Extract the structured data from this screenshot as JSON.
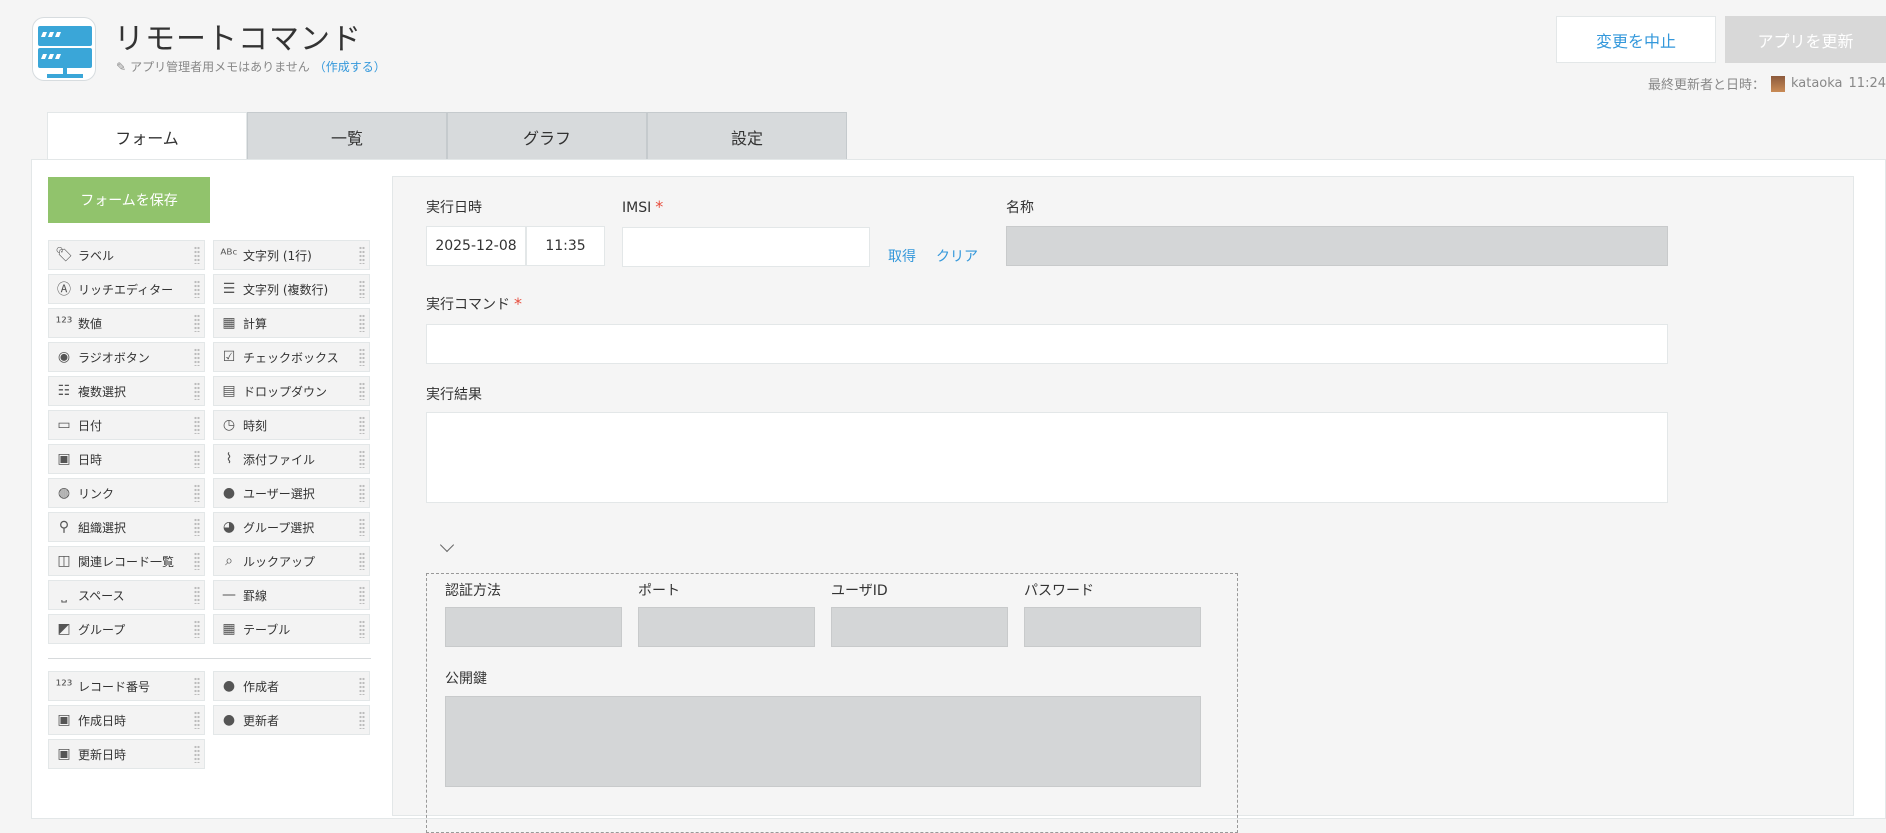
{
  "app": {
    "title": "リモートコマンド",
    "memo_text": "アプリ管理者用メモはありません",
    "memo_link": "（作成する）"
  },
  "header": {
    "cancel_label": "変更を中止",
    "update_label": "アプリを更新",
    "last_updated_label": "最終更新者と日時：",
    "last_updated_user": "kataoka",
    "last_updated_time": "11:24"
  },
  "tabs": [
    {
      "label": "フォーム"
    },
    {
      "label": "一覧"
    },
    {
      "label": "グラフ"
    },
    {
      "label": "設定"
    }
  ],
  "save_form_label": "フォームを保存",
  "palette": {
    "fields": [
      {
        "label": "ラベル",
        "icon": "tag-icon"
      },
      {
        "label": "文字列 (1行)",
        "icon": "abc-icon"
      },
      {
        "label": "リッチエディター",
        "icon": "richtext-icon"
      },
      {
        "label": "文字列 (複数行)",
        "icon": "multiline-icon"
      },
      {
        "label": "数値",
        "icon": "number-icon"
      },
      {
        "label": "計算",
        "icon": "calculator-icon"
      },
      {
        "label": "ラジオボタン",
        "icon": "radio-icon"
      },
      {
        "label": "チェックボックス",
        "icon": "checkbox-icon"
      },
      {
        "label": "複数選択",
        "icon": "multiselect-icon"
      },
      {
        "label": "ドロップダウン",
        "icon": "dropdown-icon"
      },
      {
        "label": "日付",
        "icon": "date-icon"
      },
      {
        "label": "時刻",
        "icon": "clock-icon"
      },
      {
        "label": "日時",
        "icon": "datetime-icon"
      },
      {
        "label": "添付ファイル",
        "icon": "paperclip-icon"
      },
      {
        "label": "リンク",
        "icon": "globe-icon"
      },
      {
        "label": "ユーザー選択",
        "icon": "user-icon"
      },
      {
        "label": "組織選択",
        "icon": "org-icon"
      },
      {
        "label": "グループ選択",
        "icon": "group-icon"
      },
      {
        "label": "関連レコード一覧",
        "icon": "related-records-icon"
      },
      {
        "label": "ルックアップ",
        "icon": "lookup-icon"
      },
      {
        "label": "スペース",
        "icon": "space-icon"
      },
      {
        "label": "罫線",
        "icon": "hr-icon"
      },
      {
        "label": "グループ",
        "icon": "folder-icon"
      },
      {
        "label": "テーブル",
        "icon": "table-icon"
      }
    ],
    "system_fields": [
      {
        "label": "レコード番号",
        "icon": "number-icon"
      },
      {
        "label": "作成者",
        "icon": "user-icon"
      },
      {
        "label": "作成日時",
        "icon": "datetime-icon"
      },
      {
        "label": "更新者",
        "icon": "user-icon"
      },
      {
        "label": "更新日時",
        "icon": "datetime-icon"
      }
    ]
  },
  "form": {
    "exec_datetime_label": "実行日時",
    "exec_date_value": "2025-12-08",
    "exec_time_value": "11:35",
    "imsi_label": "IMSI",
    "required_mark": "*",
    "get_link": "取得",
    "clear_link": "クリア",
    "name_label": "名称",
    "command_label": "実行コマンド",
    "result_label": "実行結果",
    "auth_label": "認証方法",
    "port_label": "ポート",
    "userid_label": "ユーザID",
    "password_label": "パスワード",
    "pubkey_label": "公開鍵"
  },
  "colors": {
    "accent": "#3498db",
    "save_green": "#91c36c",
    "required_red": "#e74c3c"
  }
}
